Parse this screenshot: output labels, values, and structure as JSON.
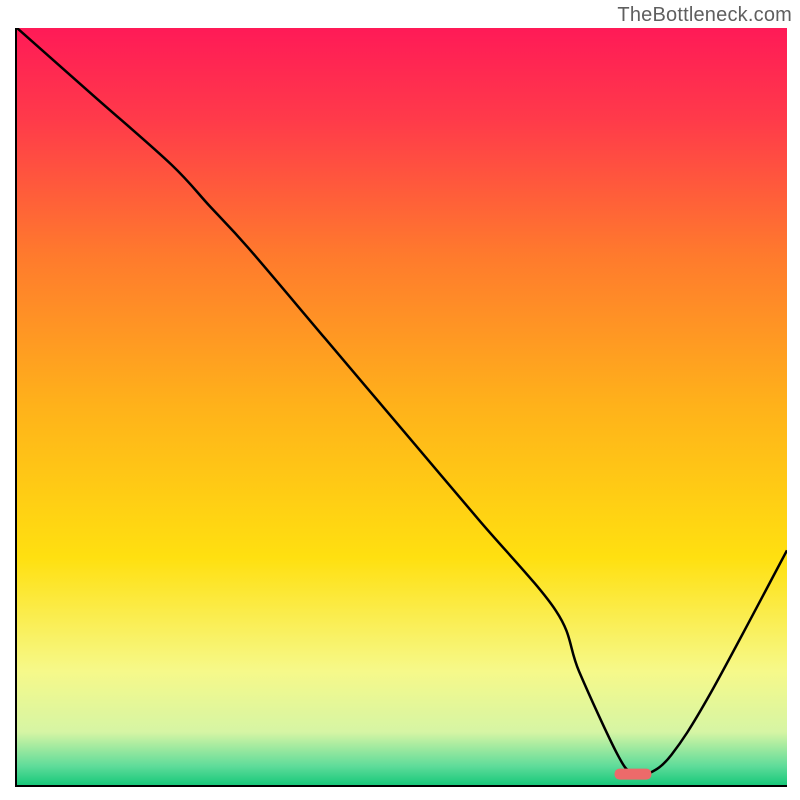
{
  "watermark": "TheBottleneck.com",
  "chart_data": {
    "type": "line",
    "title": "",
    "xlabel": "",
    "ylabel": "",
    "xlim": [
      0,
      100
    ],
    "ylim": [
      0,
      100
    ],
    "grid": false,
    "gradient_stops": [
      {
        "offset": 0.0,
        "color": "#ff1a57"
      },
      {
        "offset": 0.12,
        "color": "#ff3a4a"
      },
      {
        "offset": 0.3,
        "color": "#ff7a2d"
      },
      {
        "offset": 0.5,
        "color": "#ffb21a"
      },
      {
        "offset": 0.7,
        "color": "#ffe010"
      },
      {
        "offset": 0.85,
        "color": "#f6f98a"
      },
      {
        "offset": 0.93,
        "color": "#d6f5a4"
      },
      {
        "offset": 0.975,
        "color": "#5fdc9a"
      },
      {
        "offset": 1.0,
        "color": "#18c87a"
      }
    ],
    "series": [
      {
        "name": "bottleneck-curve",
        "x": [
          0,
          10,
          20,
          25,
          30,
          40,
          50,
          60,
          70,
          73,
          78,
          80,
          82,
          85,
          90,
          100
        ],
        "y": [
          100,
          91,
          82,
          76.5,
          71,
          59,
          47,
          35,
          23,
          15,
          4,
          1.5,
          1.5,
          4,
          12,
          31
        ]
      }
    ],
    "marker": {
      "name": "optimal-marker",
      "x": 80,
      "y": 1.5,
      "width_frac": 0.048,
      "color": "#ed6a6a",
      "mismatch_percent": 1.5
    }
  }
}
